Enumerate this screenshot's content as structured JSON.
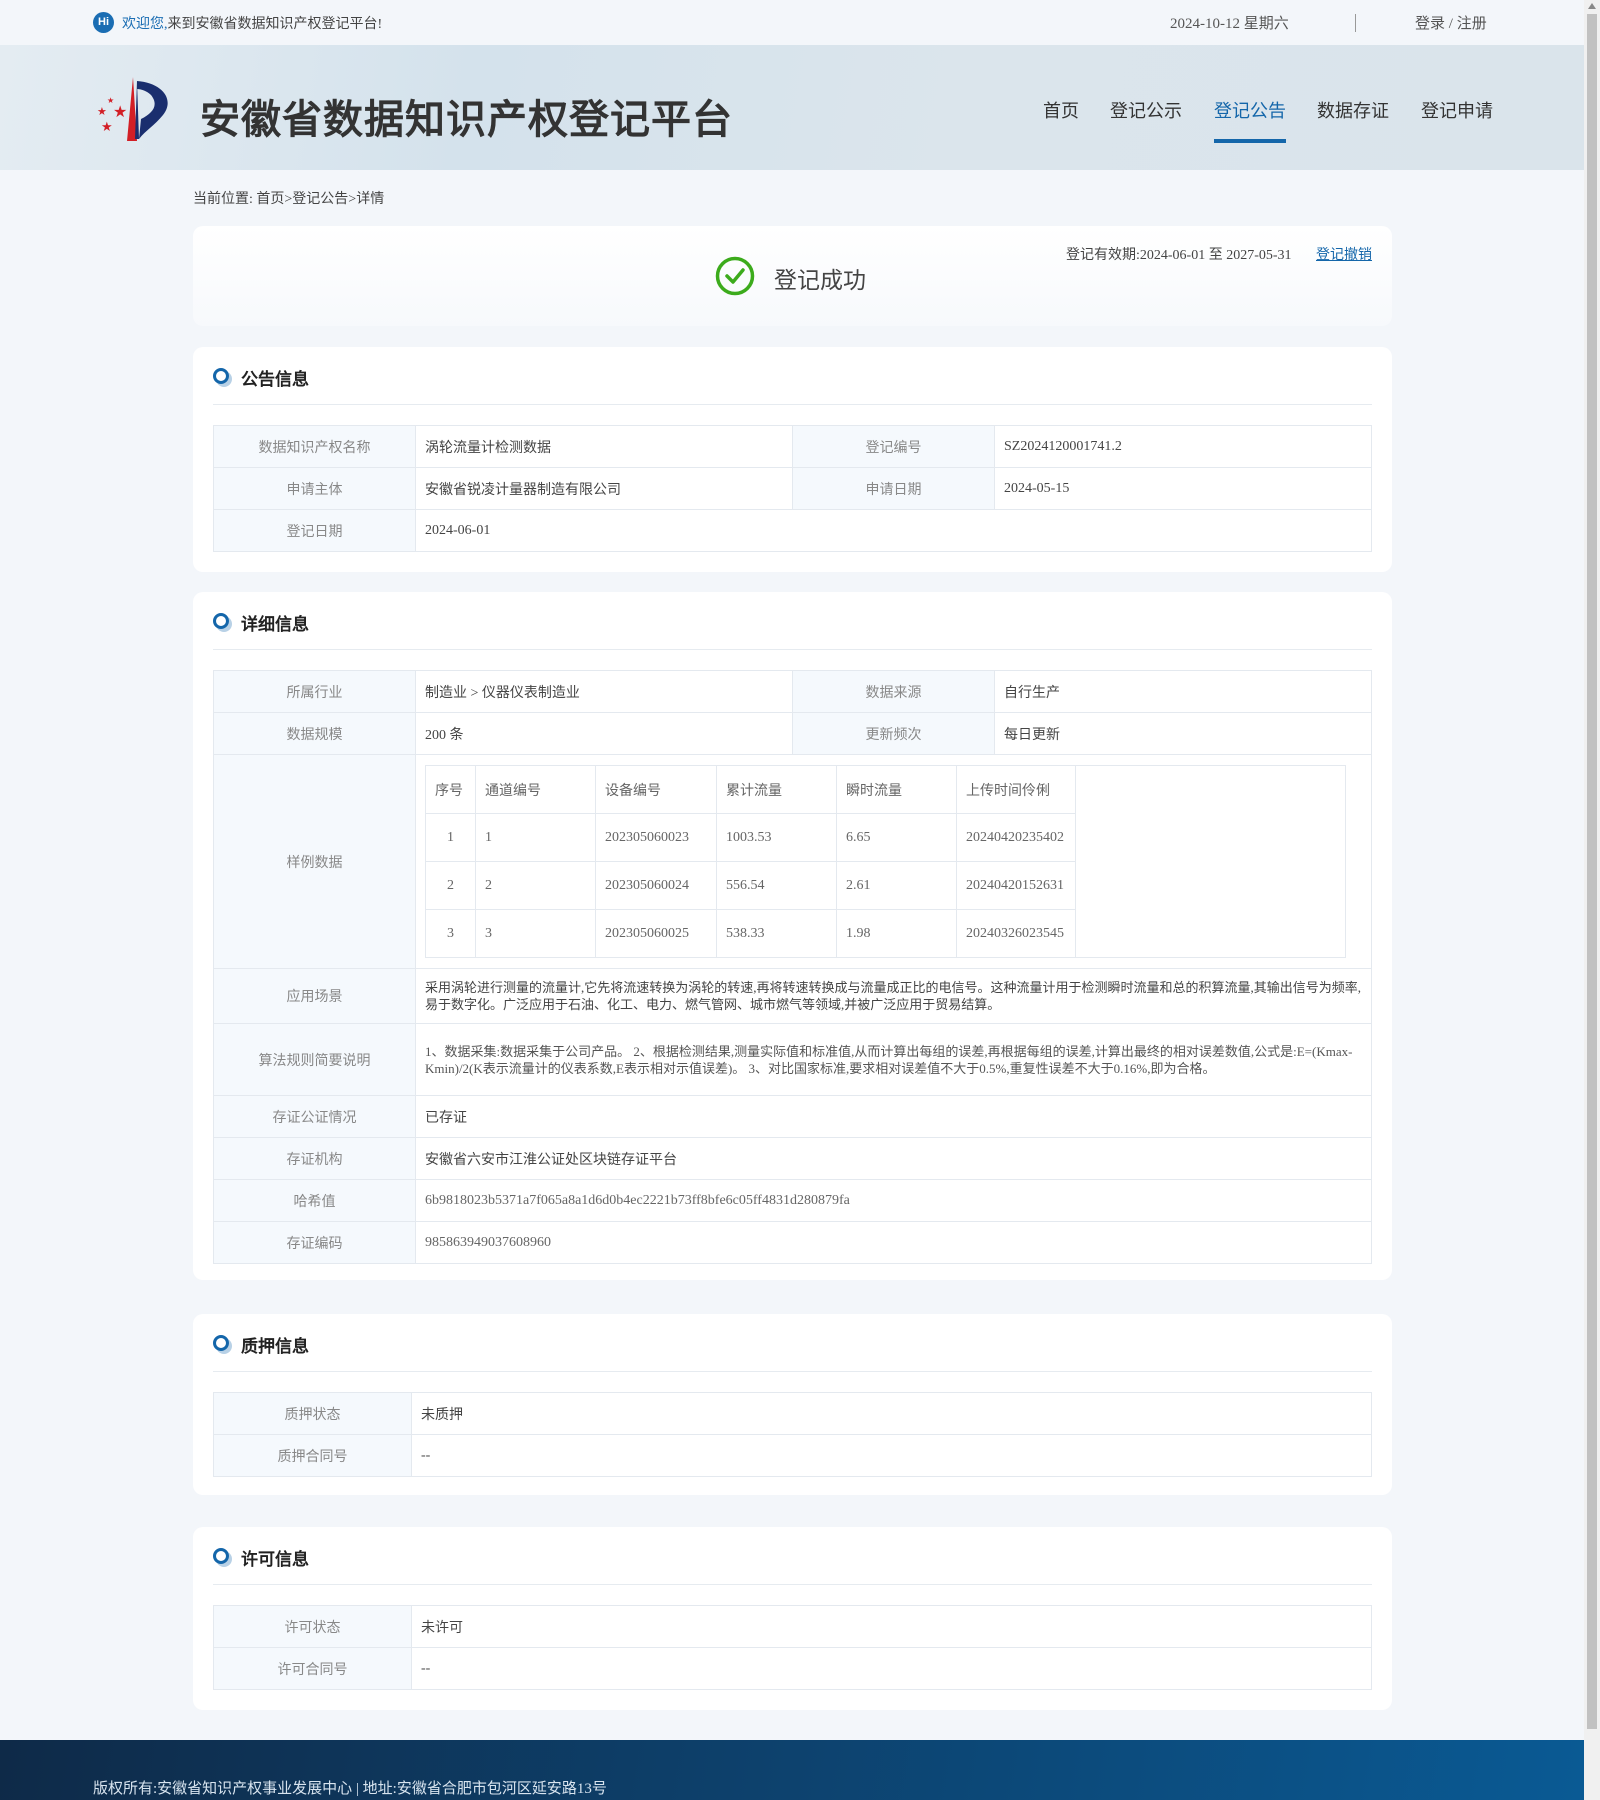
{
  "topbar": {
    "hi": "Hi",
    "welcome_highlight": "欢迎您,",
    "welcome_rest": "来到安徽省数据知识产权登记平台!",
    "date": "2024-10-12 星期六",
    "login": "登录",
    "slash": " / ",
    "register": "注册"
  },
  "header": {
    "title": "安徽省数据知识产权登记平台",
    "nav": [
      "首页",
      "登记公示",
      "登记公告",
      "数据存证",
      "登记申请"
    ],
    "active_nav": "登记公告"
  },
  "breadcrumb": {
    "label": "当前位置:",
    "items": [
      "首页",
      "登记公告",
      "详情"
    ],
    "separator": ">"
  },
  "status": {
    "text": "登记成功",
    "validity": "登记有效期:2024-06-01 至 2027-05-31",
    "revoke": "登记撤销"
  },
  "notice": {
    "title": "公告信息",
    "rows": [
      {
        "l1": "数据知识产权名称",
        "v1": "涡轮流量计检测数据",
        "l2": "登记编号",
        "v2": "SZ2024120001741.2"
      },
      {
        "l1": "申请主体",
        "v1": "安徽省锐凌计量器制造有限公司",
        "l2": "申请日期",
        "v2": "2024-05-15"
      },
      {
        "l1": "登记日期",
        "v1": "2024-06-01"
      }
    ]
  },
  "detail": {
    "title": "详细信息",
    "industry_label": "所属行业",
    "industry": "制造业 > 仪器仪表制造业",
    "source_label": "数据来源",
    "source": "自行生产",
    "scale_label": "数据规模",
    "scale": "200 条",
    "freq_label": "更新频次",
    "freq": "每日更新",
    "sample_label": "样例数据",
    "sample_headers": [
      "序号",
      "通道编号",
      "设备编号",
      "累计流量",
      "瞬时流量",
      "上传时间伶俐"
    ],
    "sample_rows": [
      [
        "1",
        "1",
        "202305060023",
        "1003.53",
        "6.65",
        "20240420235402"
      ],
      [
        "2",
        "2",
        "202305060024",
        "556.54",
        "2.61",
        "20240420152631"
      ],
      [
        "3",
        "3",
        "202305060025",
        "538.33",
        "1.98",
        "20240326023545"
      ]
    ],
    "scene_label": "应用场景",
    "scene": "采用涡轮进行测量的流量计,它先将流速转换为涡轮的转速,再将转速转换成与流量成正比的电信号。这种流量计用于检测瞬时流量和总的积算流量,其输出信号为频率,易于数字化。广泛应用于石油、化工、电力、燃气管网、城市燃气等领域,并被广泛应用于贸易结算。",
    "algo_label": "算法规则简要说明",
    "algo": "1、数据采集:数据采集于公司产品。 2、根据检测结果,测量实际值和标准值,从而计算出每组的误差,再根据每组的误差,计算出最终的相对误差数值,公式是:E=(Kmax-Kmin)/2(K表示流量计的仪表系数,E表示相对示值误差)。 3、对比国家标准,要求相对误差值不大于0.5%,重复性误差不大于0.16%,即为合格。",
    "notary_label": "存证公证情况",
    "notary": "已存证",
    "org_label": "存证机构",
    "org": "安徽省六安市江淮公证处区块链存证平台",
    "hash_label": "哈希值",
    "hash": "6b9818023b5371a7f065a8a1d6d0b4ec2221b73ff8bfe6c05ff4831d280879fa",
    "code_label": "存证编码",
    "code": "985863949037608960"
  },
  "pledge": {
    "title": "质押信息",
    "status_label": "质押状态",
    "status": "未质押",
    "contract_label": "质押合同号",
    "contract": "--"
  },
  "license": {
    "title": "许可信息",
    "status_label": "许可状态",
    "status": "未许可",
    "contract_label": "许可合同号",
    "contract": "--"
  },
  "footer": {
    "text": "版权所有:安徽省知识产权事业发展中心 | 地址:安徽省合肥市包河区延安路13号"
  },
  "colors": {
    "accent": "#1466aa",
    "success": "#3cab1c",
    "footer": "#0d426e"
  }
}
